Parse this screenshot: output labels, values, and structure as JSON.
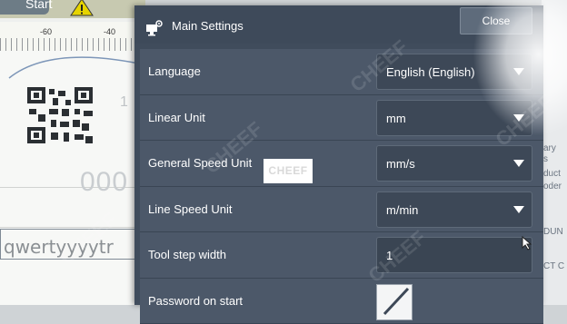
{
  "background_app": {
    "start_label": "Start",
    "ruler_ticks": [
      "-60",
      "-40"
    ],
    "ghost_text": "000",
    "ghost_digit": "1",
    "text_object": "qwertyyyytr"
  },
  "right_strip_fragments": [
    "ary",
    "s",
    "duct",
    "oder",
    "DUN",
    "CT C"
  ],
  "dialog": {
    "title": "Main Settings",
    "close_label": "Close",
    "rows": [
      {
        "label": "Language",
        "value": "English (English)",
        "control": "dropdown"
      },
      {
        "label": "Linear Unit",
        "value": "mm",
        "control": "dropdown"
      },
      {
        "label": "General Speed Unit",
        "value": "mm/s",
        "control": "dropdown"
      },
      {
        "label": "Line Speed Unit",
        "value": "m/min",
        "control": "dropdown"
      },
      {
        "label": "Tool step width",
        "value": "1",
        "control": "input"
      },
      {
        "label": "Password on start",
        "value": "",
        "control": "checkbox",
        "checked": true
      }
    ]
  },
  "watermark": "CHEEF",
  "colors": {
    "dialog_bg": "#404c5c",
    "row_bg": "#4c5869",
    "field_bg": "#3d4857",
    "close_button": "#5e6b7b"
  }
}
